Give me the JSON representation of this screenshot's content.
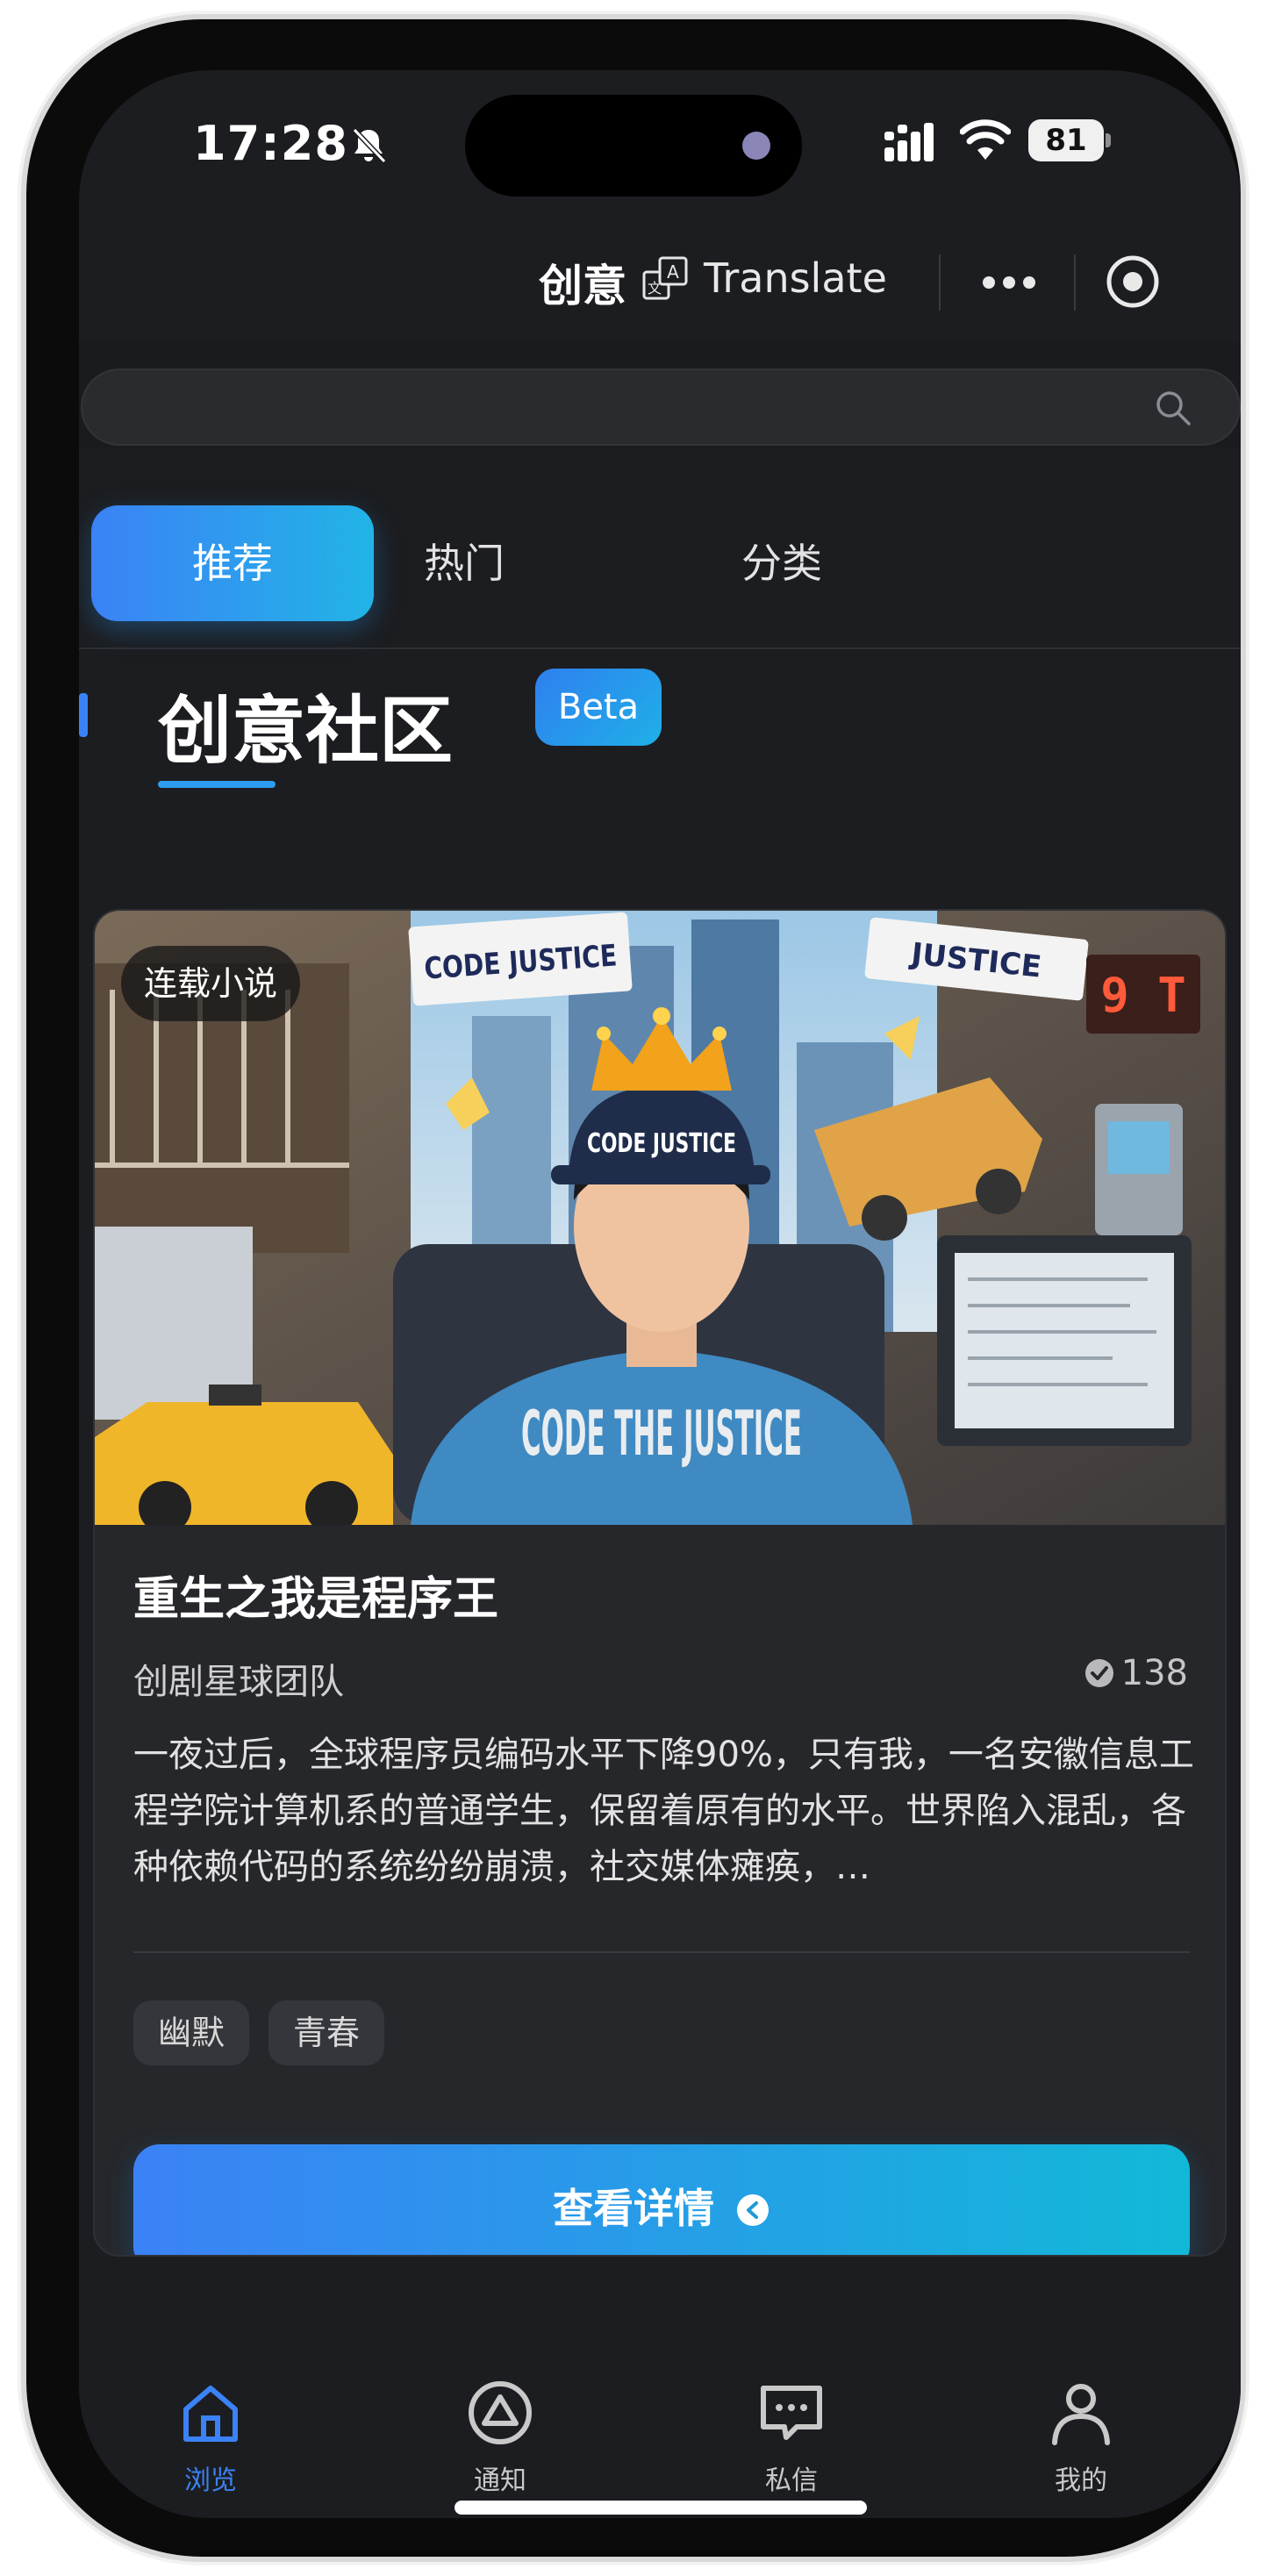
{
  "status_bar": {
    "time": "17:28",
    "battery": "81"
  },
  "nav": {
    "title": "创意",
    "translate_label": "Translate"
  },
  "search": {
    "placeholder": "",
    "value": ""
  },
  "tabs": [
    {
      "label": "推荐",
      "active": true
    },
    {
      "label": "热门",
      "active": false
    },
    {
      "label": "分类",
      "active": false
    }
  ],
  "section": {
    "title": "创意社区",
    "badge": "Beta"
  },
  "card": {
    "category": "连载小说",
    "title": "重生之我是程序王",
    "author": "创剧星球团队",
    "likes": "138",
    "description": "一夜过后，全球程序员编码水平下降90%，只有我，一名安徽信息工程学院计算机系的普通学生，保留着原有的水平。世界陷入混乱，各种依赖代码的系统纷纷崩溃，社交媒体瘫痪，…",
    "tags": [
      "幽默",
      "青春"
    ],
    "button_label": "查看详情",
    "cover_texts": {
      "sign_left": "CODE JUSTICE",
      "sign_right": "JUSTICE",
      "hat": "CODE JUSTICE",
      "shirt": "CODE THE JUSTICE",
      "neon": "9 T"
    }
  },
  "bottom_nav": [
    {
      "label": "浏览",
      "icon": "home-icon",
      "active": true
    },
    {
      "label": "通知",
      "icon": "triangle-circle-icon",
      "active": false
    },
    {
      "label": "私信",
      "icon": "message-icon",
      "active": false
    },
    {
      "label": "我的",
      "icon": "user-icon",
      "active": false
    }
  ],
  "colors": {
    "accent": "#3b82f6",
    "accent_end": "#12b8d8",
    "background": "#1c1d20",
    "card": "#26272b"
  }
}
